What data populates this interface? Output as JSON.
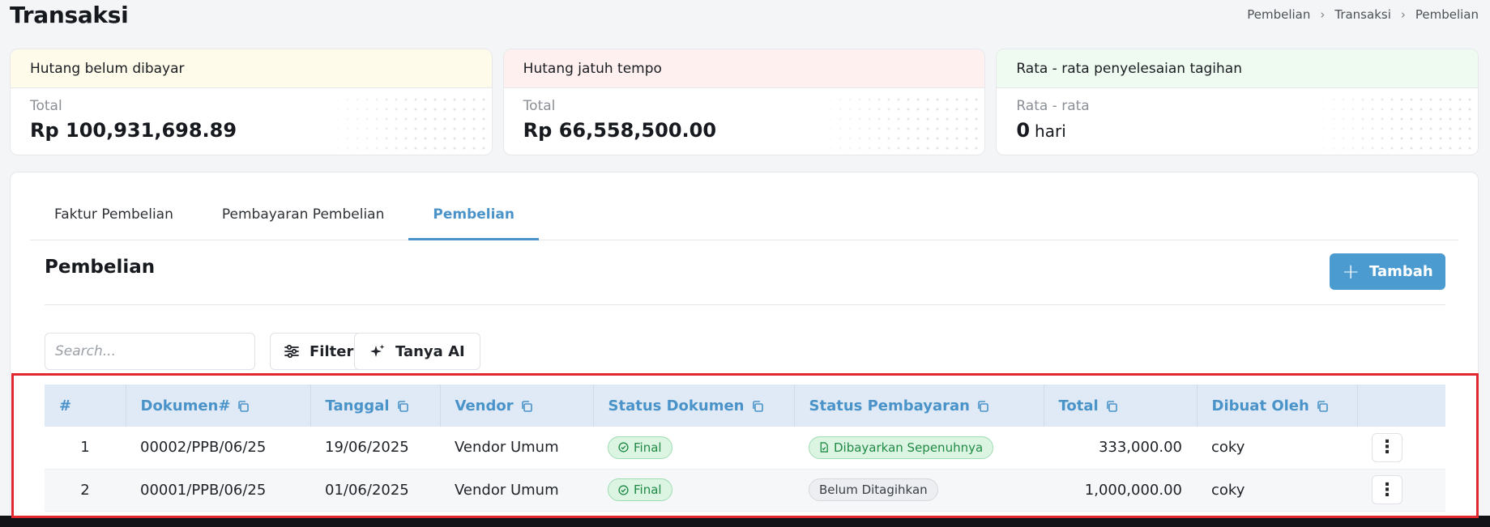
{
  "page": {
    "title": "Transaksi"
  },
  "breadcrumb": [
    "Pembelian",
    "Transaksi",
    "Pembelian"
  ],
  "stats": [
    {
      "heading": "Hutang belum dibayar",
      "label": "Total",
      "value": "Rp 100,931,698.89",
      "unit": ""
    },
    {
      "heading": "Hutang jatuh tempo",
      "label": "Total",
      "value": "Rp 66,558,500.00",
      "unit": ""
    },
    {
      "heading": "Rata - rata penyelesaian tagihan",
      "label": "Rata - rata",
      "value": "0",
      "unit": "hari"
    }
  ],
  "tabs": [
    {
      "label": "Faktur Pembelian",
      "active": false
    },
    {
      "label": "Pembayaran Pembelian",
      "active": false
    },
    {
      "label": "Pembelian",
      "active": true
    }
  ],
  "section": {
    "title": "Pembelian",
    "add_label": "Tambah"
  },
  "toolbar": {
    "search_placeholder": "Search...",
    "filter_label": "Filter",
    "ai_label": "Tanya AI"
  },
  "table": {
    "columns": [
      "#",
      "Dokumen#",
      "Tanggal",
      "Vendor",
      "Status Dokumen",
      "Status Pembayaran",
      "Total",
      "Dibuat Oleh"
    ],
    "rows": [
      {
        "no": "1",
        "doc": "00002/PPB/06/25",
        "date": "19/06/2025",
        "vendor": "Vendor Umum",
        "doc_status": "Final",
        "pay_status": "Dibayarkan Sepenuhnya",
        "total": "333,000.00",
        "by": "coky"
      },
      {
        "no": "2",
        "doc": "00001/PPB/06/25",
        "date": "01/06/2025",
        "vendor": "Vendor Umum",
        "doc_status": "Final",
        "pay_status": "Belum Ditagihkan",
        "total": "1,000,000.00",
        "by": "coky"
      }
    ]
  },
  "colors": {
    "accent": "#4a93c9",
    "primary_button": "#4b9bd0",
    "highlight": "#e1282f"
  }
}
